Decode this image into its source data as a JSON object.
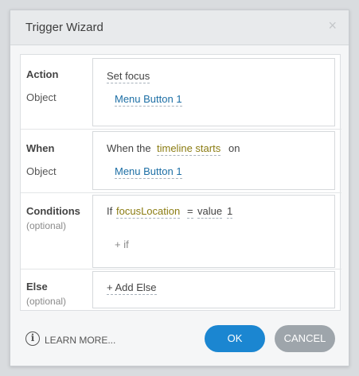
{
  "dialog": {
    "title": "Trigger Wizard",
    "close_glyph": "×"
  },
  "action": {
    "label": "Action",
    "value": "Set focus",
    "object_label": "Object",
    "object_value": "Menu Button 1"
  },
  "when": {
    "label": "When",
    "prefix": "When the",
    "event": "timeline starts",
    "suffix": "on",
    "object_label": "Object",
    "object_value": "Menu Button 1"
  },
  "conditions": {
    "label": "Conditions",
    "optional": "(optional)",
    "if_text": "If",
    "variable": "focusLocation",
    "operator": "=",
    "value_type": "value",
    "value": "1",
    "add_if": "+ if"
  },
  "else": {
    "label": "Else",
    "optional": "(optional)",
    "add_else": "+ Add Else"
  },
  "footer": {
    "info_glyph": "i",
    "learn_more": "LEARN MORE...",
    "ok_label": "OK",
    "cancel_label": "CANCEL"
  },
  "colors": {
    "accent": "#1b86d1",
    "cancel": "#9ea5ab",
    "link": "#1d6fa5",
    "variable": "#8b7c12"
  }
}
